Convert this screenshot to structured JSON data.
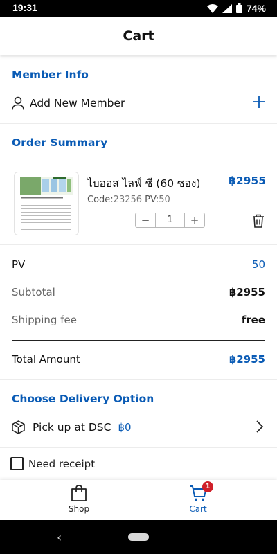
{
  "status_bar": {
    "time": "19:31",
    "battery": "74%"
  },
  "header": {
    "title": "Cart"
  },
  "member": {
    "section_title": "Member Info",
    "add_label": "Add New Member"
  },
  "order": {
    "section_title": "Order Summary",
    "item": {
      "name": "ไบออส ไลฟ์ ซี (60 ซอง)",
      "price": "฿2955",
      "code_label": "Code:",
      "code": "23256",
      "pv_label": "PV:",
      "pv": "50",
      "quantity": "1",
      "minus": "−",
      "plus": "+"
    }
  },
  "summary": {
    "pv_label": "PV",
    "pv_value": "50",
    "subtotal_label": "Subtotal",
    "subtotal_value": "฿2955",
    "shipping_label": "Shipping fee",
    "shipping_value": "free",
    "total_label": "Total Amount",
    "total_value": "฿2955"
  },
  "delivery": {
    "section_title": "Choose Delivery Option",
    "option_label": "Pick up at DSC",
    "option_cost": "฿0"
  },
  "receipt": {
    "label": "Need receipt",
    "checked": false
  },
  "bottom_nav": {
    "shop_label": "Shop",
    "cart_label": "Cart",
    "cart_badge": "1"
  },
  "colors": {
    "accent": "#0a5bb5",
    "badge": "#d0202a"
  }
}
